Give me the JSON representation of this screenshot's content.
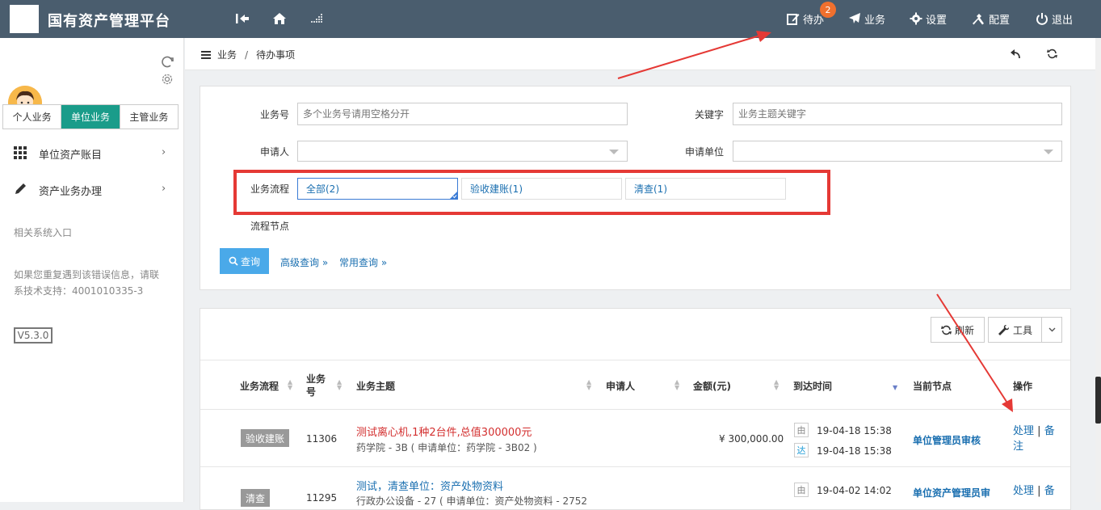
{
  "header": {
    "app_title": "国有资产管理平台",
    "badge_count": "2",
    "nav": [
      {
        "label": "待办",
        "icon": "edit-icon"
      },
      {
        "label": "业务",
        "icon": "paper-plane-icon"
      },
      {
        "label": "设置",
        "icon": "gear-icon"
      },
      {
        "label": "配置",
        "icon": "tools-icon"
      },
      {
        "label": "退出",
        "icon": "power-icon"
      }
    ]
  },
  "sidebar": {
    "tabs": [
      "个人业务",
      "单位业务",
      "主管业务"
    ],
    "active_tab": 1,
    "menu": [
      {
        "label": "单位资产账目",
        "arrow": "›"
      },
      {
        "label": "资产业务办理",
        "arrow": "›"
      }
    ],
    "related_title": "相关系统入口",
    "support_line1": "如果您重复遇到该错误信息，请联",
    "support_line2": "系技术支持：4001010335-3",
    "version": "V5.3.0"
  },
  "breadcrumb": {
    "items": [
      "业务",
      "待办事项"
    ],
    "separator": "/"
  },
  "filters": {
    "biz_no_label": "业务号",
    "biz_no_placeholder": "多个业务号请用空格分开",
    "keyword_label": "关键字",
    "keyword_placeholder": "业务主题关键字",
    "applicant_label": "申请人",
    "applicant_unit_label": "申请单位",
    "flow_label": "业务流程",
    "flow_options": [
      "全部(2)",
      "验收建账(1)",
      "清查(1)"
    ],
    "node_label": "流程节点",
    "query_btn": "查询",
    "advanced_link": "高级查询 »",
    "common_link": "常用查询 »"
  },
  "toolbar": {
    "refresh": "刷新",
    "tools": "工具"
  },
  "table": {
    "headers": [
      "业务流程",
      "业务号",
      "业务主题",
      "申请人",
      "金额(元)",
      "到达时间",
      "当前节点",
      "操作"
    ],
    "rows": [
      {
        "flow": "验收建账",
        "no": "11306",
        "subject": "测试离心机,1种2台件,总值300000元",
        "sub_info": "药学院 - 3B ( 申请单位：药学院 - 3B02 )",
        "amount": "¥ 300,000.00",
        "from_tag": "由",
        "from_time": "19-04-18 15:38",
        "to_tag": "达",
        "to_time": "19-04-18 15:38",
        "node": "单位管理员审核",
        "op1": "处理",
        "op_sep": "|",
        "op2a": "备",
        "op2b": "注"
      },
      {
        "flow": "清查",
        "no": "11295",
        "subject": "测试，清查单位：资产处物资料",
        "sub_info": "行政办公设备 - 27 ( 申请单位：资产处物资料 - 2752",
        "from_tag": "由",
        "from_time": "19-04-02 14:02",
        "node": "单位资产管理员审",
        "op1": "处理",
        "op_sep": "|",
        "op2a": "备"
      }
    ]
  },
  "colors": {
    "topbar": "#4a5d6e",
    "accent": "#1a9c8a",
    "annotation_red": "#e53935",
    "query_blue": "#4aa9e9"
  }
}
